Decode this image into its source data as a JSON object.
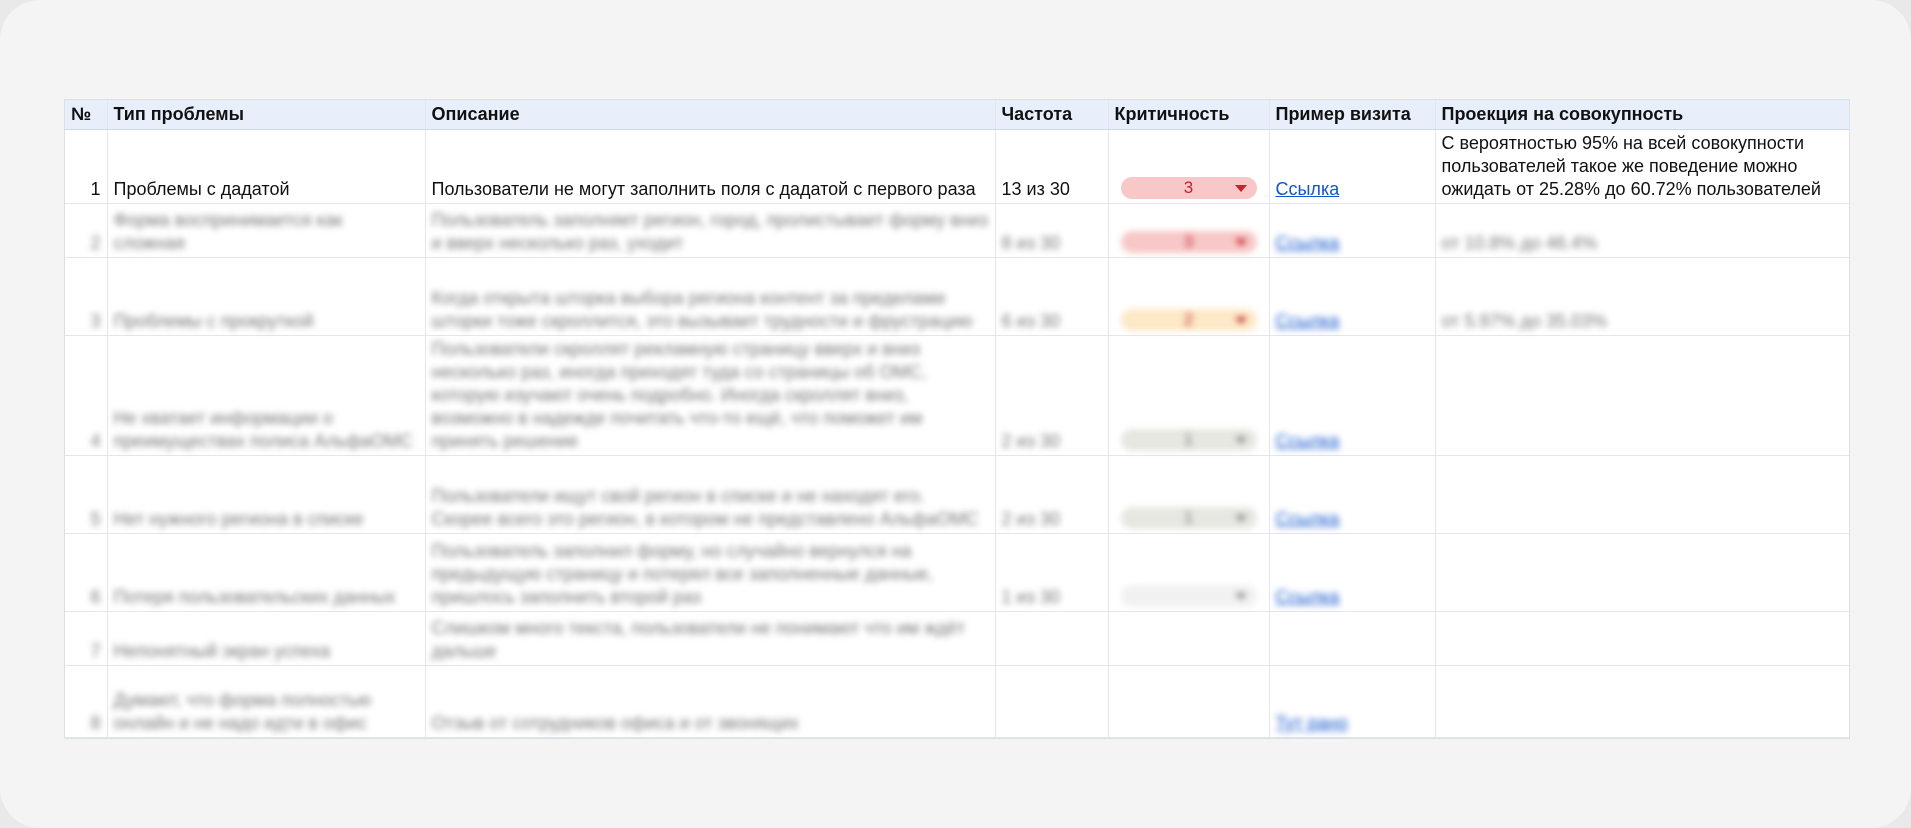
{
  "headers": [
    "№",
    "Тип проблемы",
    "Описание",
    "Частота",
    "Критичность",
    "Пример визита",
    "Проекция на совокупность"
  ],
  "rows": [
    {
      "num": "1",
      "type": "Проблемы с дадатой",
      "desc": "Пользователи не могут заполнить поля с дадатой с первого раза",
      "freq": "13 из 30",
      "crit": "3",
      "crit_color": "#f8c7c7",
      "link": "Ссылка",
      "proj": "С вероятностью 95% на всей совокупности пользователей такое же поведение можно ожидать от 25.28% до 60.72% пользователей"
    },
    {
      "num": "2",
      "type": "Форма воспринимается как сложная",
      "desc": "Пользователь заполняет регион, город, пролистывает форму вниз и вверх несколько раз, уходит",
      "freq": "8 из 30",
      "crit": "3",
      "crit_color": "#f8c7c7",
      "link": "Ссылка",
      "proj": "от 10.8% до 46.4%"
    },
    {
      "num": "3",
      "type": "Проблемы с прокруткой",
      "desc": "Когда открыта шторка выбора региона контент за пределами шторки тоже скроллится, это вызывает трудности и фрустрацию",
      "freq": "6 из 30",
      "crit": "2",
      "crit_color": "#fde8c8",
      "link": "Ссылка",
      "proj": "от 5.97% до 35.03%"
    },
    {
      "num": "4",
      "type": "Не хватает информации о преимуществах полиса АльфаОМС",
      "desc": "Пользователи скроллят рекламную страницу вверх и вниз несколько раз, иногда приходят туда со страницы об ОМС, которую изучают очень подробно. Иногда скроллят вниз, возможно в надежде почитать что-то ещё, что поможет им принять решение",
      "freq": "2 из 30",
      "crit": "1",
      "crit_color": "#e6e7e1",
      "link": "Ссылка",
      "proj": ""
    },
    {
      "num": "5",
      "type": "Нет нужного региона в списке",
      "desc": "Пользователи ищут свой регион в списке и не находят его. Скорее всего это регион, в котором не представлено АльфаОМС",
      "freq": "2 из 30",
      "crit": "1",
      "crit_color": "#e6e7e1",
      "link": "Ссылка",
      "proj": ""
    },
    {
      "num": "6",
      "type": "Потеря пользовательских данных",
      "desc": "Пользователь заполнил форму, но случайно вернулся на предыдущую страницу и потерял все заполненные данные, пришлось заполнить второй раз",
      "freq": "1 из 30",
      "crit": "",
      "crit_color": "#f1f1f1",
      "link": "Ссылка",
      "proj": ""
    },
    {
      "num": "7",
      "type": "Непонятный экран успеха",
      "desc": "Слишком много текста, пользователи не понимают что им ждёт дальше",
      "freq": "",
      "crit": "",
      "crit_color": "",
      "link": "",
      "proj": ""
    },
    {
      "num": "8",
      "type": "Думают, что форма полностью онлайн и не надо идти в офис",
      "desc": "Отзыв от сотрудников офиса и от звонящих",
      "freq": "",
      "crit": "",
      "crit_color": "",
      "link": "Тут рано",
      "proj": ""
    }
  ]
}
